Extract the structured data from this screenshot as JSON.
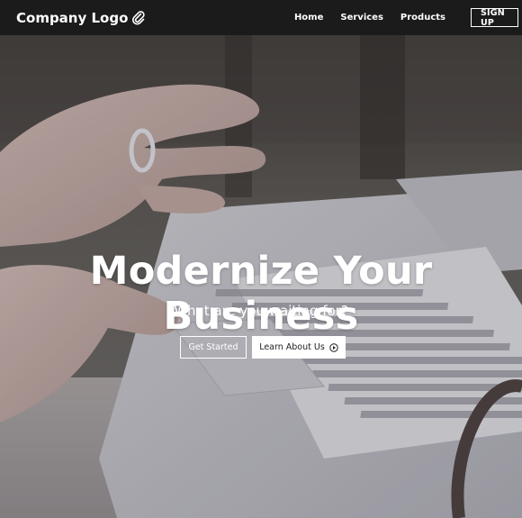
{
  "navbar": {
    "brand": "Company Logo",
    "brand_icon": "paperclip-icon",
    "links": [
      "Home",
      "Services",
      "Products"
    ],
    "signup_label": "SIGN UP"
  },
  "hero": {
    "title": "Modernize Your Business",
    "subtitle": "What are you waiting for?",
    "primary_button": "Get Started",
    "secondary_button": "Learn About Us",
    "secondary_icon": "play-circle-icon"
  },
  "colors": {
    "navbar_bg": "#1b1b1c",
    "text": "#ffffff",
    "button_fill": "#ffffff"
  }
}
